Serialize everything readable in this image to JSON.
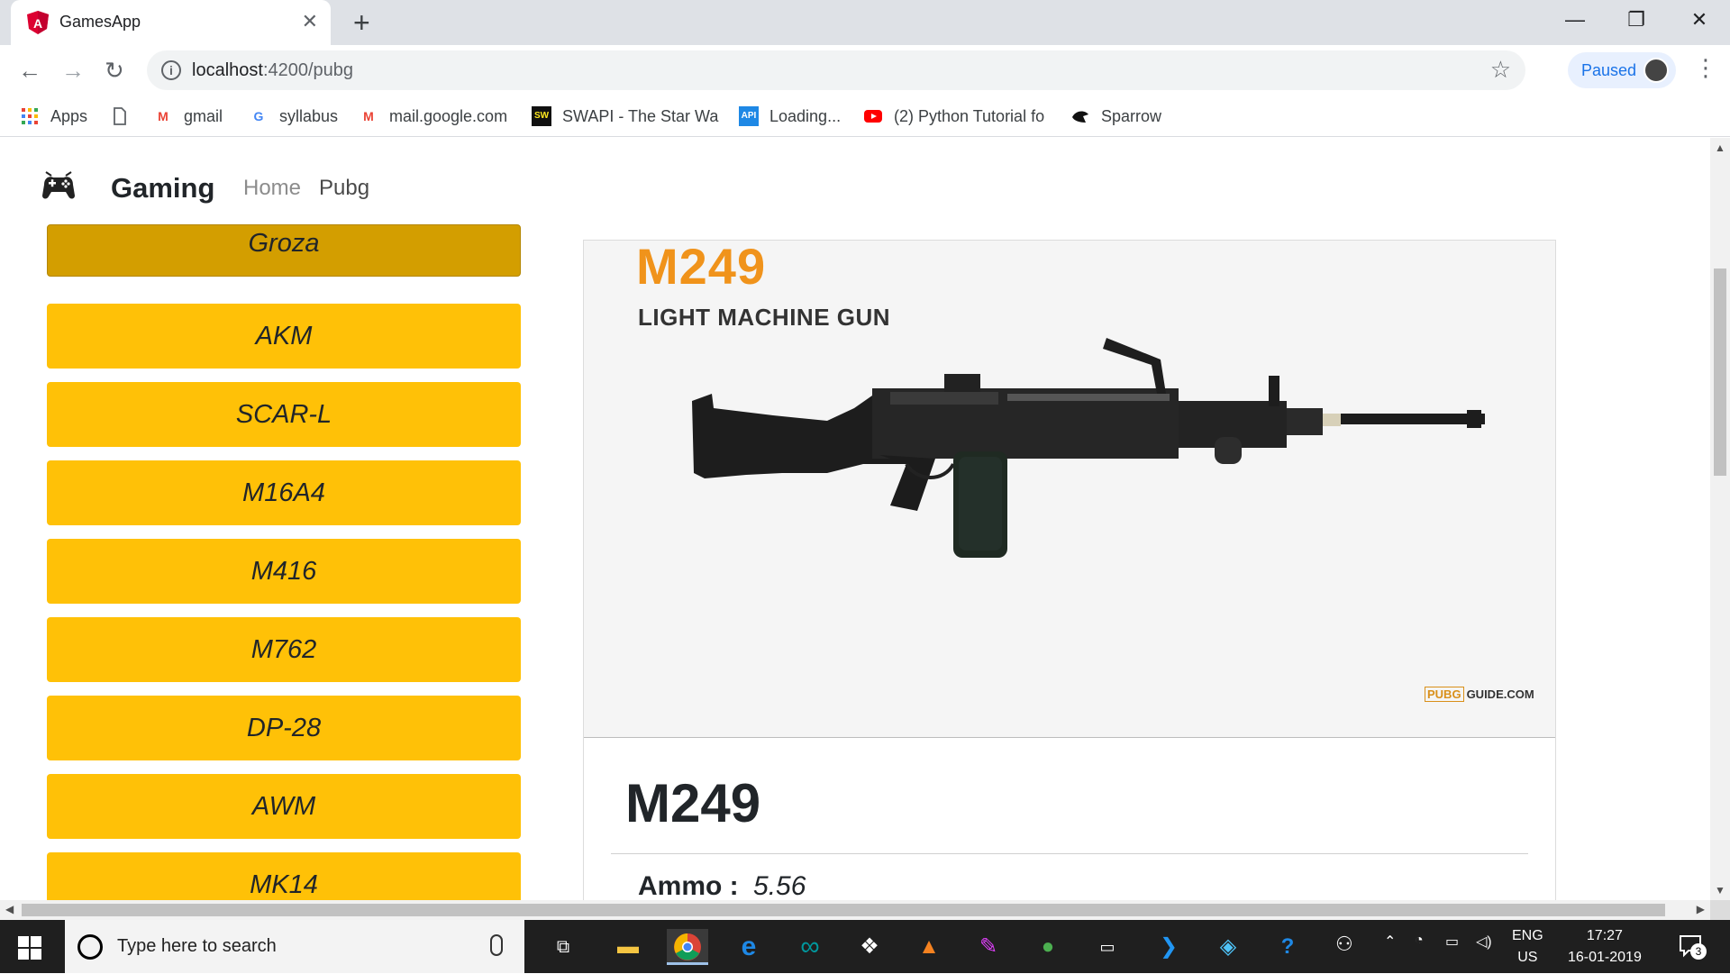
{
  "browser": {
    "tab_title": "GamesApp",
    "tab_close": "✕",
    "new_tab": "+",
    "window": {
      "minimize": "—",
      "restore": "❐",
      "close": "✕"
    },
    "url_host": "localhost",
    "url_path": ":4200/pubg",
    "profile_label": "Paused"
  },
  "bookmarks": [
    {
      "label": "Apps",
      "icon": "apps-grid-icon"
    },
    {
      "label": "",
      "icon": "page-icon"
    },
    {
      "label": "gmail",
      "icon": "gmail-icon"
    },
    {
      "label": "syllabus",
      "icon": "google-icon"
    },
    {
      "label": "mail.google.com",
      "icon": "gmail-icon"
    },
    {
      "label": "SWAPI - The Star Wa",
      "icon": "swapi-icon"
    },
    {
      "label": "Loading...",
      "icon": "api-icon"
    },
    {
      "label": "(2) Python Tutorial fo",
      "icon": "youtube-icon"
    },
    {
      "label": "Sparrow",
      "icon": "sparrow-icon"
    }
  ],
  "app": {
    "brand": "Gaming",
    "nav": {
      "home": "Home",
      "pubg": "Pubg"
    },
    "weapons": [
      "Groza",
      "AKM",
      "SCAR-L",
      "M16A4",
      "M416",
      "M762",
      "DP-28",
      "AWM",
      "MK14"
    ],
    "selected_weapon": "Groza",
    "detail": {
      "image_name": "M249",
      "image_type": "LIGHT MACHINE GUN",
      "watermark_badge": "PUBG",
      "watermark_text": "GUIDE.COM",
      "title": "M249",
      "ammo_label": "Ammo :",
      "ammo_value": "5.56"
    }
  },
  "taskbar": {
    "search_placeholder": "Type here to search",
    "lang_top": "ENG",
    "lang_bottom": "US",
    "time": "17:27",
    "date": "16-01-2019",
    "notification_count": "3",
    "colors": {
      "taskbar_bg": "#1f1f1f",
      "accent": "#ffc107",
      "accent_active": "#d39e00",
      "brand_orange": "#f0931b"
    }
  }
}
